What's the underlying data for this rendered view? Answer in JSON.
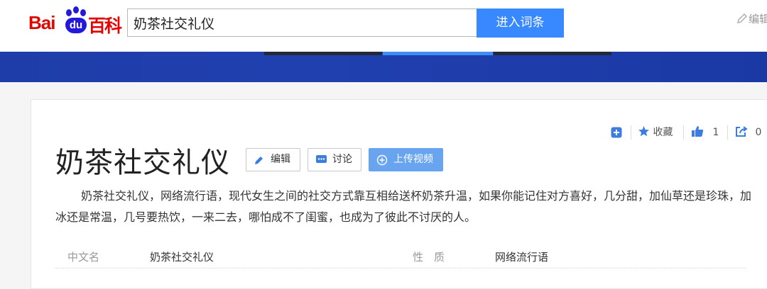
{
  "logo": {
    "part1": "Bai",
    "part2": "du",
    "part3": "百科"
  },
  "search": {
    "value": "奶茶社交礼仪",
    "button_label": "进入词条"
  },
  "header": {
    "edit_label": "编辑"
  },
  "entry": {
    "title": "奶茶社交礼仪",
    "buttons": {
      "edit": "编辑",
      "discuss": "讨论",
      "upload_video": "上传视频"
    },
    "tools": {
      "favorite": "收藏",
      "like_count": "1",
      "share_count": "0"
    },
    "summary": "奶茶社交礼仪，网络流行语，现代女生之间的社交方式靠互相给送杯奶茶升温，如果你能记住对方喜好，几分甜，加仙草还是珍珠，加冰还是常温，几号要热饮，一来二去，哪怕成不了闺蜜，也成为了彼此不讨厌的人。",
    "basic_info": [
      {
        "label": "中文名",
        "value": "奶茶社交礼仪"
      },
      {
        "label": "性　质",
        "value": "网络流行语"
      }
    ]
  },
  "colors": {
    "brand_red": "#e10602",
    "brand_blue": "#2319dc",
    "search_button": "#3888ff",
    "nav_band": "#1e3da8",
    "upload_button": "#68a4f0"
  }
}
